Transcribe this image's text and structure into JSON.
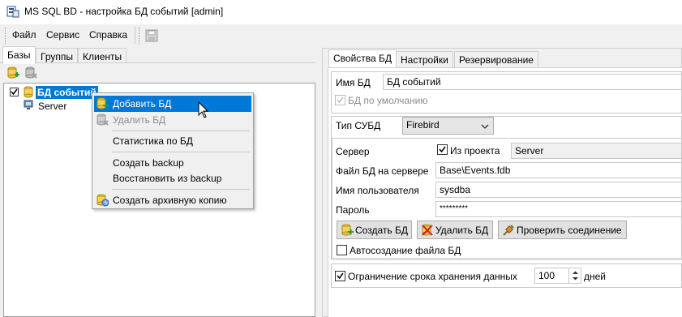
{
  "window": {
    "title": "MS SQL BD - настройка БД событий [admin]"
  },
  "menu": {
    "file": "Файл",
    "service": "Сервис",
    "help": "Справка"
  },
  "left_tabs": {
    "databases": "Базы",
    "groups": "Группы",
    "clients": "Клиенты"
  },
  "tree": {
    "db_node": "БД событий",
    "server_node": "Server"
  },
  "context_menu": {
    "add_db": "Добавить БД",
    "delete_db": "Удалить БД",
    "db_stats": "Статистика по БД",
    "create_backup": "Создать backup",
    "restore_backup": "Восстановить из backup",
    "create_archive": "Создать архивную копию"
  },
  "right_tabs": {
    "db_props": "Свойства БД",
    "settings": "Настройки",
    "reservation": "Резервирование"
  },
  "props": {
    "db_name_label": "Имя БД",
    "db_name_value": "БД событий",
    "default_db_label": "БД по умолчанию",
    "dbms_type_label": "Тип СУБД",
    "dbms_type_value": "Firebird",
    "server_label": "Сервер",
    "from_project_label": "Из проекта",
    "server_value": "Server",
    "db_file_label": "Файл БД на сервере",
    "db_file_value": "Base\\Events.fdb",
    "username_label": "Имя пользователя",
    "username_value": "sysdba",
    "password_label": "Пароль",
    "password_value": "*********",
    "create_db_button": "Создать БД",
    "delete_db_button": "Удалить БД",
    "check_connection_button": "Проверить соединение",
    "autocreate_label": "Автосоздание файла БД",
    "retention_label": "Ограничение срока хранения данных",
    "retention_value": "100",
    "days_label": "дней"
  },
  "colors": {
    "selection": "#0078d7",
    "highlight_menu": "#0078d7",
    "window_bg": "#f0f0f0"
  }
}
